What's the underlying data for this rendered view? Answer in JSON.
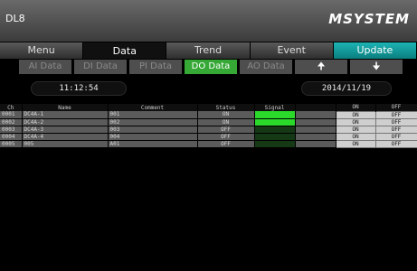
{
  "header": {
    "device": "DL8",
    "logo": "MSYSTEM"
  },
  "tabs": [
    "Menu",
    "Data",
    "Trend",
    "Event",
    "Update"
  ],
  "subtabs": [
    "AI Data",
    "DI Data",
    "PI Data",
    "DO Data",
    "AO Data"
  ],
  "arrows": {
    "up": "🠉",
    "down": "🠋"
  },
  "time": "11:12:54",
  "date": "2014/11/19",
  "columns": {
    "ch": "Ch",
    "name": "Name",
    "comment": "Comment",
    "status": "Status",
    "signal": "Signal",
    "on": "ON",
    "off": "OFF"
  },
  "rows": [
    {
      "ch": "0001",
      "name": "DC4A-1",
      "comment": "001",
      "status": "ON",
      "signal": "on",
      "on": "ON",
      "off": "OFF"
    },
    {
      "ch": "0002",
      "name": "DC4A-2",
      "comment": "002",
      "status": "ON",
      "signal": "on",
      "on": "ON",
      "off": "OFF"
    },
    {
      "ch": "0003",
      "name": "DC4A-3",
      "comment": "003",
      "status": "OFF",
      "signal": "off",
      "on": "ON",
      "off": "OFF"
    },
    {
      "ch": "0004",
      "name": "DC4A-4",
      "comment": "004",
      "status": "OFF",
      "signal": "off",
      "on": "ON",
      "off": "OFF"
    },
    {
      "ch": "0005",
      "name": "005",
      "comment": "A01",
      "status": "OFF",
      "signal": "off",
      "on": "ON",
      "off": "OFF"
    }
  ],
  "colors": {
    "accent": "#35a835",
    "update": "#1db3b3",
    "signal_on": "#2bd92b",
    "signal_off": "#153815"
  }
}
